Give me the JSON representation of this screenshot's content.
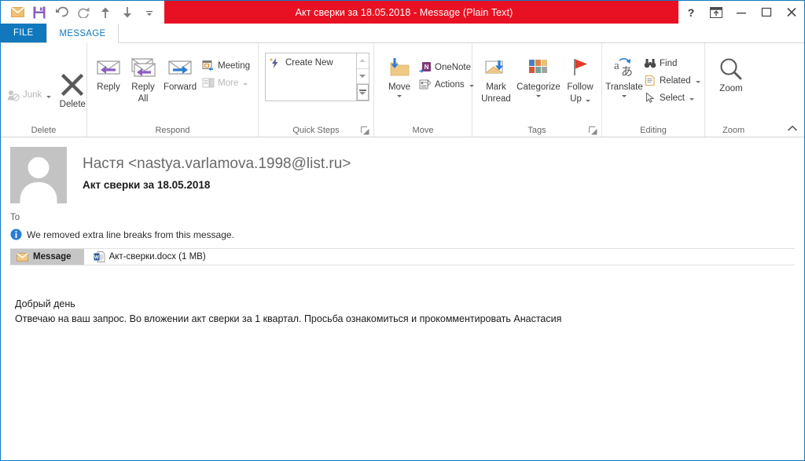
{
  "window": {
    "title": "Акт сверки за 18.05.2018 -  Message (Plain Text)",
    "accent_red": "#e81123",
    "accent_blue": "#1278be"
  },
  "quick_access": {
    "items": [
      {
        "name": "mail-icon",
        "label": "Mail"
      },
      {
        "name": "save-icon",
        "label": "Save"
      },
      {
        "name": "undo-icon",
        "label": "Undo"
      },
      {
        "name": "redo-icon",
        "label": "Redo"
      },
      {
        "name": "previous-item-icon",
        "label": "Previous Item"
      },
      {
        "name": "next-item-icon",
        "label": "Next Item"
      },
      {
        "name": "customize-qat-icon",
        "label": "Customize Quick Access Toolbar"
      }
    ]
  },
  "window_controls": {
    "help": "?",
    "ribbon_display_options": "Ribbon Display Options",
    "minimize": "Minimize",
    "maximize": "Maximize",
    "close": "Close"
  },
  "tabs": {
    "file": "FILE",
    "message": "MESSAGE"
  },
  "ribbon": {
    "groups": {
      "delete": {
        "label": "Delete",
        "junk": "Junk",
        "delete": "Delete"
      },
      "respond": {
        "label": "Respond",
        "reply": "Reply",
        "reply_all": "Reply\nAll",
        "reply_all_line1": "Reply",
        "reply_all_line2": "All",
        "forward": "Forward",
        "meeting": "Meeting",
        "more": "More"
      },
      "quick_steps": {
        "label": "Quick Steps",
        "create_new": "Create New"
      },
      "move": {
        "label": "Move",
        "move": "Move",
        "onenote": "OneNote",
        "actions": "Actions"
      },
      "tags": {
        "label": "Tags",
        "mark_unread_line1": "Mark",
        "mark_unread_line2": "Unread",
        "categorize": "Categorize",
        "follow_up_line1": "Follow",
        "follow_up_line2": "Up",
        "categorize_colors": [
          "#4a7ebb",
          "#e0853f",
          "#ebc17a",
          "#d5563a",
          "#72a497",
          "#a3a3a3"
        ]
      },
      "editing": {
        "label": "Editing",
        "translate": "Translate",
        "find": "Find",
        "related": "Related",
        "select": "Select"
      },
      "zoom": {
        "label": "Zoom",
        "zoom": "Zoom"
      }
    }
  },
  "message": {
    "sender": "Настя <nastya.varlamova.1998@list.ru>",
    "subject": "Акт сверки за 18.05.2018",
    "to_label": "To",
    "infobar": "We removed extra line breaks from this message.",
    "message_tab": "Message",
    "attachment": "Акт-сверки.docx (1 MB)",
    "body_line1": "Добрый день",
    "body_line2": "Отвечаю на ваш запрос. Во вложении акт сверки за 1 квартал. Просьба ознакомиться и прокомментировать Анастасия"
  }
}
